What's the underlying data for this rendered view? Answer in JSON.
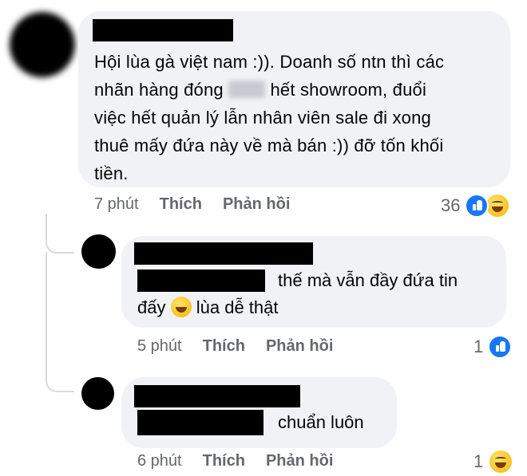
{
  "main_comment": {
    "text_part1": "Hội lùa gà việt nam :)). Doanh số ntn thì các\nnhãn hàng đóng ",
    "text_part2": " hết showroom, đuổi\nviệc hết quản lý lẫn nhân viên sale đi xong\nthuê mấy đứa này về mà bán :)) đỡ tốn khối\ntiền.",
    "time": "7 phút",
    "like_label": "Thích",
    "reply_label": "Phản hồi",
    "reaction_count": "36",
    "reaction_icons": [
      "like-icon",
      "haha-icon"
    ]
  },
  "reply_1": {
    "text_line1": "thế mà vẫn đầy đứa tin",
    "text_line2_a": "đấy",
    "text_line2_b": "lùa dễ thật",
    "inline_emoji": "laughing-tears-emoji",
    "time": "5 phút",
    "like_label": "Thích",
    "reply_label": "Phản hồi",
    "reaction_count": "1",
    "reaction_icons": [
      "like-icon"
    ]
  },
  "reply_2": {
    "text": "chuẩn luôn",
    "time": "6 phút",
    "like_label": "Thích",
    "reply_label": "Phản hồi",
    "reaction_count": "1",
    "reaction_icons": [
      "haha-icon"
    ]
  },
  "colors": {
    "bubble_bg": "#f0f2f5",
    "meta_text": "#65676b",
    "like_blue": "#1877f2",
    "redaction": "#000000"
  }
}
